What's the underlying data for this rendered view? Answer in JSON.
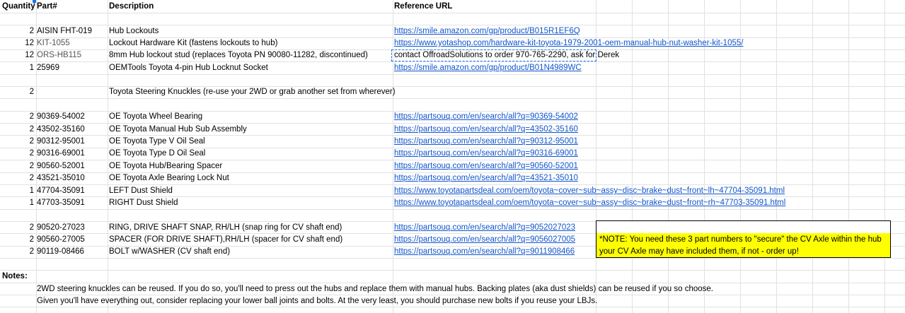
{
  "headers": {
    "quantity": "Quantity",
    "part": "Part#",
    "description": "Description",
    "url": "Reference URL"
  },
  "rows": [
    {
      "qty": "2",
      "part": "AISIN FHT-019",
      "desc": "Hub Lockouts",
      "url": "https://smile.amazon.com/gp/product/B015R1EF6Q"
    },
    {
      "qty": "12",
      "part": "KIT-1055",
      "desc": "Lockout Hardware Kit (fastens lockouts to hub)",
      "url": "https://www.yotashop.com/hardware-kit-toyota-1979-2001-oem-manual-hub-nut-washer-kit-1055/"
    },
    {
      "qty": "12",
      "part": "ORS-HB115",
      "desc": "8mm Hub lockout stud (replaces Toyota PN 90080-11282, discontinued)",
      "url": "contact OffroadSolutions to order 970-765-2290, ask for Derek"
    },
    {
      "qty": "1",
      "part": "25969",
      "desc": "OEMTools Toyota 4-pin Hub Locknut Socket",
      "url": "https://smile.amazon.com/gp/product/B01N4989WC"
    },
    {
      "qty": "2",
      "part": "",
      "desc": "Toyota Steering Knuckles (re-use your 2WD or grab another set from wherever)",
      "url": ""
    },
    {
      "qty": "2",
      "part": "90369-54002",
      "desc": "OE Toyota Wheel Bearing",
      "url": "https://partsouq.com/en/search/all?q=90369-54002"
    },
    {
      "qty": "2",
      "part": "43502-35160",
      "desc": "OE Toyota Manual Hub Sub Assembly",
      "url": "https://partsouq.com/en/search/all?q=43502-35160"
    },
    {
      "qty": "2",
      "part": "90312-95001",
      "desc": "OE Toyota Type V Oil Seal",
      "url": "https://partsouq.com/en/search/all?q=90312-95001"
    },
    {
      "qty": "2",
      "part": "90316-69001",
      "desc": "OE Toyota Type D Oil Seal",
      "url": "https://partsouq.com/en/search/all?q=90316-69001"
    },
    {
      "qty": "2",
      "part": "90560-52001",
      "desc": "OE Toyota Hub/Bearing Spacer",
      "url": "https://partsouq.com/en/search/all?q=90560-52001"
    },
    {
      "qty": "2",
      "part": "43521-35010",
      "desc": "OE Toyota Axle Bearing Lock Nut",
      "url": "https://partsouq.com/en/search/all?q=43521-35010"
    },
    {
      "qty": "1",
      "part": "47704-35091",
      "desc": "LEFT Dust Shield",
      "url": "https://www.toyotapartsdeal.com/oem/toyota~cover~sub~assy~disc~brake~dust~front~lh~47704-35091.html"
    },
    {
      "qty": "1",
      "part": "47703-35091",
      "desc": "RIGHT Dust Shield",
      "url": "https://www.toyotapartsdeal.com/oem/toyota~cover~sub~assy~disc~brake~dust~front~rh~47703-35091.html"
    },
    {
      "qty": "2",
      "part": "90520-27023",
      "desc": "RING, DRIVE SHAFT SNAP, RH/LH (snap ring for CV shaft end)",
      "url": "https://partsouq.com/en/search/all?q=9052027023"
    },
    {
      "qty": "2",
      "part": "90560-27005",
      "desc": "SPACER (FOR DRIVE SHAFT),RH/LH (spacer for CV shaft end)",
      "url": "https://partsouq.com/en/search/all?q=9056027005"
    },
    {
      "qty": "2",
      "part": "90119-08466",
      "desc": "BOLT w/WASHER (CV shaft end)",
      "url": "https://partsouq.com/en/search/all?q=9011908466"
    }
  ],
  "note": {
    "line1": "*NOTE: You need these 3 part numbers to \"secure\" the CV Axle within the hub",
    "line2": "your CV Axle may have included them, if not - order up!",
    "highlight_color": "#ffff00"
  },
  "notes": {
    "label": "Notes:",
    "line1": "2WD steering knuckles can be reused. If you do so, you'll need to press out the hubs and replace them with manual hubs. Backing plates (aka dust shields) can be reused if you so choose.",
    "line2": "Given you'll have everything out, consider replacing your lower ball joints and bolts. At the very least, you should purchase new bolts if you reuse your LBJs."
  },
  "colors": {
    "link": "#1155cc",
    "grid": "#e1e1e1",
    "selection": "#1a73e8"
  }
}
